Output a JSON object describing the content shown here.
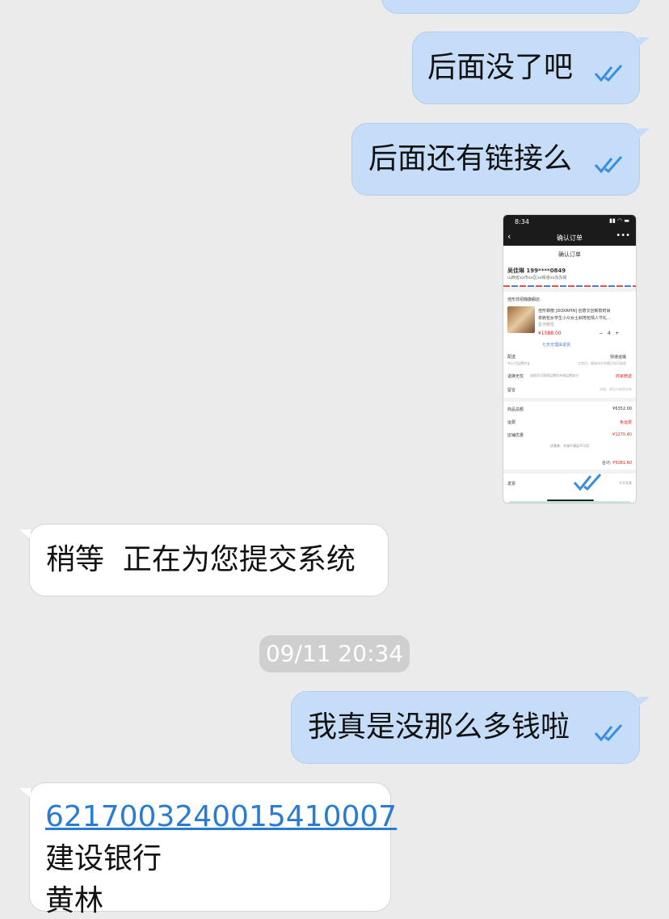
{
  "messages": {
    "m1": "后面没了吧",
    "m2": "后面还有链接么",
    "m3": "稍等  正在为您提交系统",
    "m4": "我真是没那么多钱啦",
    "m5_account": "6217003240015410007",
    "m5_bank": "建设银行",
    "m5_name": "黄林"
  },
  "timestamp": "09/11 20:34",
  "screenshot": {
    "time": "8:34",
    "title": "确认订单",
    "subtitle": "确认订单",
    "name_phone": "吴佳琳 199****0849",
    "address": "山西省xx市xx区xx街道xx东东街",
    "store": "佳形非绍璐旗舰店",
    "product_line1": "佳形菲丽 [DOXRPIN] 创意文创新款时尚",
    "product_line2": "单肩包女学生小众女士斜挎包情人节礼…",
    "product_spec": "星河夜空",
    "price": "¥1588.00",
    "qty": "4",
    "service": "七天无理由退货",
    "delivery_label": "配送",
    "delivery_value": "快递运输",
    "delivery_note": "中心付运费时长",
    "delivery_note2": "工作日、周末均与节假日均可送货",
    "freight_label": "退换无忧",
    "freight_note": "退换货可获得运费险补偿运费部分",
    "freight_value": "商家赠送",
    "remark_label": "留言",
    "remark_value": "选填，请先与商家协商",
    "total_label": "商品总额",
    "total_value": "¥6352.00",
    "ship_label": "运费",
    "ship_value": "免运费",
    "discount_label": "店铺优惠",
    "discount_value": "-¥1270.40",
    "coupon_note": "优惠券、共减不满足不可用",
    "sum_label": "合计:",
    "sum_value": "¥5081.60",
    "invoice_label": "发票",
    "invoice_value": "不开发票"
  },
  "colors": {
    "outgoing": "#c5ddf8",
    "incoming": "#ffffff",
    "check": "#3b8de0",
    "link": "#2a7bd2"
  }
}
